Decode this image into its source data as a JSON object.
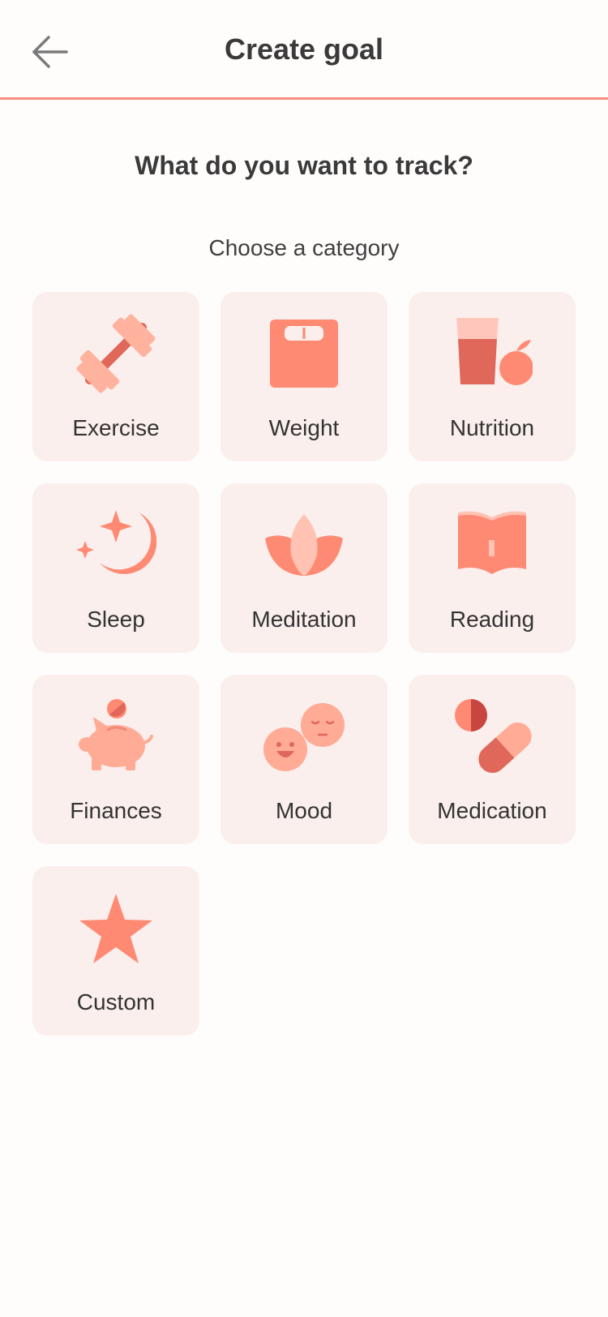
{
  "header": {
    "title": "Create goal"
  },
  "main": {
    "question": "What do you want to track?",
    "subtitle": "Choose a category",
    "categories": [
      {
        "label": "Exercise",
        "icon": "dumbbell-icon"
      },
      {
        "label": "Weight",
        "icon": "scale-icon"
      },
      {
        "label": "Nutrition",
        "icon": "food-icon"
      },
      {
        "label": "Sleep",
        "icon": "moon-icon"
      },
      {
        "label": "Meditation",
        "icon": "lotus-icon"
      },
      {
        "label": "Reading",
        "icon": "book-icon"
      },
      {
        "label": "Finances",
        "icon": "piggy-bank-icon"
      },
      {
        "label": "Mood",
        "icon": "faces-icon"
      },
      {
        "label": "Medication",
        "icon": "pill-icon"
      },
      {
        "label": "Custom",
        "icon": "star-icon"
      }
    ]
  },
  "colors": {
    "accent": "#f48d7c",
    "tile_background": "#fbefed",
    "icon_primary": "#ff8a73",
    "icon_dark": "#e0685a",
    "icon_light": "#ffb29e"
  }
}
